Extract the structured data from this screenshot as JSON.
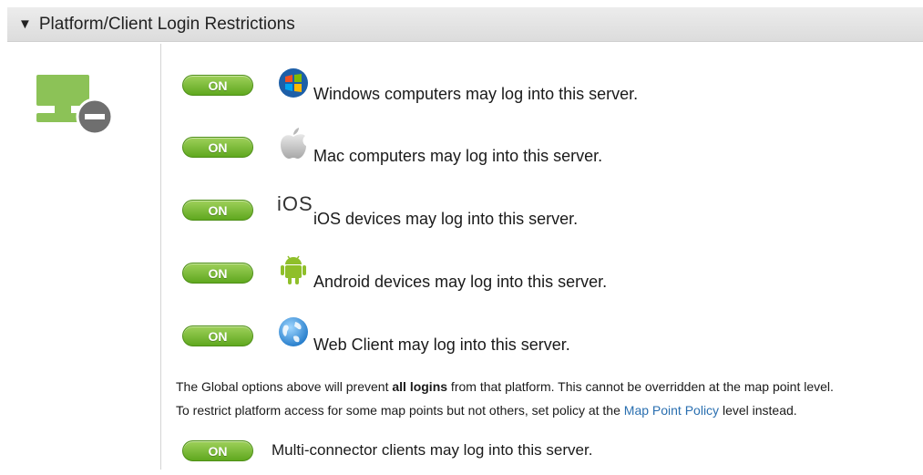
{
  "header": {
    "title": "Platform/Client Login Restrictions",
    "collapse_glyph": "▼"
  },
  "side_icon": "computer-blocked-icon",
  "rows": [
    {
      "toggle": "ON",
      "icon": "windows-icon",
      "text": "Windows computers may log into this server."
    },
    {
      "toggle": "ON",
      "icon": "apple-icon",
      "text": "Mac computers may log into this server."
    },
    {
      "toggle": "ON",
      "icon": "ios-icon",
      "icon_text": "iOS",
      "text": "iOS devices may log into this server."
    },
    {
      "toggle": "ON",
      "icon": "android-icon",
      "text": "Android devices may log into this server."
    },
    {
      "toggle": "ON",
      "icon": "globe-icon",
      "text": "Web Client may log into this server."
    }
  ],
  "note": {
    "line1_pre": "The Global options above will prevent ",
    "line1_bold": "all logins",
    "line1_post": " from that platform. This cannot be overridden at the map point level.",
    "line2_pre": "To restrict platform access for some map points but not others, set policy at the ",
    "line2_link": "Map Point Policy",
    "line2_post": " level instead."
  },
  "multi": {
    "toggle": "ON",
    "text": "Multi-connector clients may log into this server."
  },
  "colors": {
    "toggle_green": "#6db52a",
    "link_blue": "#2a6fb0",
    "monitor_green": "#8cc257",
    "badge_gray": "#6f6f6f"
  }
}
